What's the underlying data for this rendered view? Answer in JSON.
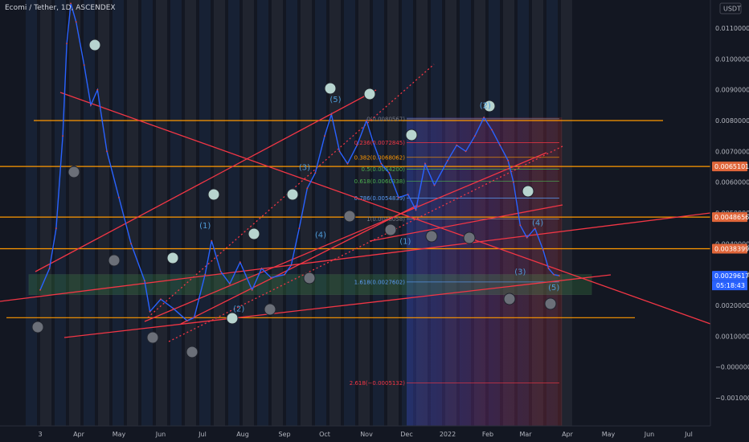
{
  "header": {
    "title": "Ecomi / Tether, 1D, ASCENDEX"
  },
  "currency_button": {
    "label": "USDT"
  },
  "price_tags": [
    {
      "label": "0.0065101",
      "value": 0.0065101,
      "color": "#e0663a"
    },
    {
      "label": "0.0048656",
      "value": 0.0048656,
      "color": "#e0663a"
    },
    {
      "label": "0.0038399",
      "value": 0.0038399,
      "color": "#e0663a"
    },
    {
      "label": "0.0029617",
      "value": 0.0029617,
      "color": "#2962ff"
    }
  ],
  "countdown": {
    "label": "05:18:43"
  },
  "colors": {
    "background": "#131722",
    "line": "#2962ff",
    "trendline": "#f23645",
    "horizontal": "#ff9800",
    "circle": "#9fbbb8",
    "wave_label": "#4f9bd6"
  },
  "chart_data": {
    "type": "line",
    "title": "Ecomi / Tether, 1D, ASCENDEX",
    "ylabel": "USDT",
    "ylim": [
      -0.00135,
      0.01185
    ],
    "y_ticks": [
      "0.0110000",
      "0.0100000",
      "0.0090000",
      "0.0080000",
      "0.0070000",
      "0.0060000",
      "0.0050000",
      "0.0040000",
      "0.0030000",
      "0.0020000",
      "0.0010000",
      "−0.0000000",
      "−0.0010000"
    ],
    "x_ticks": [
      "3",
      "Apr",
      "May",
      "Jun",
      "Jul",
      "Aug",
      "Sep",
      "Oct",
      "Nov",
      "Dec",
      "2022",
      "Feb",
      "Mar",
      "Apr",
      "May",
      "Jun",
      "Jul"
    ],
    "x_range": [
      "2021-03-03",
      "2022-07-20"
    ],
    "series": [
      {
        "name": "",
        "dates": [
          "2021-03-03",
          "2021-03-10",
          "2021-03-15",
          "2021-03-20",
          "2021-03-23",
          "2021-03-26",
          "2021-03-30",
          "2021-04-05",
          "2021-04-10",
          "2021-04-15",
          "2021-04-22",
          "2021-05-01",
          "2021-05-10",
          "2021-05-20",
          "2021-05-24",
          "2021-06-01",
          "2021-06-10",
          "2021-06-20",
          "2021-06-25",
          "2021-07-03",
          "2021-07-08",
          "2021-07-15",
          "2021-07-22",
          "2021-07-30",
          "2021-08-08",
          "2021-08-15",
          "2021-08-22",
          "2021-09-01",
          "2021-09-06",
          "2021-09-12",
          "2021-09-18",
          "2021-09-24",
          "2021-10-01",
          "2021-10-06",
          "2021-10-12",
          "2021-10-18",
          "2021-10-25",
          "2021-11-01",
          "2021-11-06",
          "2021-11-12",
          "2021-11-18",
          "2021-11-25",
          "2021-12-02",
          "2021-12-08",
          "2021-12-15",
          "2021-12-22",
          "2022-01-01",
          "2022-01-08",
          "2022-01-15",
          "2022-01-22",
          "2022-01-29",
          "2022-02-04",
          "2022-02-10",
          "2022-02-16",
          "2022-02-20",
          "2022-02-25",
          "2022-03-02",
          "2022-03-08",
          "2022-03-14",
          "2022-03-18",
          "2022-03-22",
          "2022-03-26"
        ],
        "values": [
          0.0025,
          0.0032,
          0.0045,
          0.0075,
          0.0105,
          0.0118,
          0.0112,
          0.0098,
          0.0085,
          0.009,
          0.007,
          0.0055,
          0.004,
          0.0028,
          0.0018,
          0.0022,
          0.0019,
          0.0015,
          0.0016,
          0.003,
          0.0041,
          0.0031,
          0.0027,
          0.0034,
          0.0025,
          0.0032,
          0.0029,
          0.003,
          0.0033,
          0.0045,
          0.0058,
          0.0063,
          0.0075,
          0.0082,
          0.007,
          0.0066,
          0.0072,
          0.008,
          0.0073,
          0.0066,
          0.0063,
          0.0055,
          0.0056,
          0.0051,
          0.0066,
          0.0059,
          0.0067,
          0.0072,
          0.007,
          0.0075,
          0.0081,
          0.0077,
          0.0072,
          0.0067,
          0.006,
          0.0046,
          0.0042,
          0.0045,
          0.0038,
          0.0032,
          0.003,
          0.0029617
        ]
      }
    ],
    "horizontal_levels": [
      0.008,
      0.0065101,
      0.0048656,
      0.0038399,
      0.0016
    ],
    "fib_levels": [
      {
        "label": "0(0.0080567)",
        "value": 0.0080567,
        "color": "#787b86"
      },
      {
        "label": "0.236(0.0072845)",
        "value": 0.0072845,
        "color": "#f23645"
      },
      {
        "label": "0.382(0.0068062)",
        "value": 0.0068062,
        "color": "#ff9800"
      },
      {
        "label": "0.5(0.0064200)",
        "value": 0.00642,
        "color": "#4caf50"
      },
      {
        "label": "0.618(0.0060338)",
        "value": 0.0060338,
        "color": "#4caf50"
      },
      {
        "label": "0.786(0.0054839)",
        "value": 0.0054839,
        "color": "#5b9cf6"
      },
      {
        "label": "1(0.0048058)",
        "value": 0.0048058,
        "color": "#787b86"
      },
      {
        "label": "1.618(0.0027602)",
        "value": 0.0027602,
        "color": "#5b9cf6"
      },
      {
        "label": "2.618(−0.0005132)",
        "value": -0.0005132,
        "color": "#f23645"
      }
    ],
    "wave_labels": [
      {
        "text": "(1)",
        "date": "2021-07-03",
        "value": 0.0045
      },
      {
        "text": "(2)",
        "date": "2021-07-29",
        "value": 0.0018
      },
      {
        "text": "(3)",
        "date": "2021-09-16",
        "value": 0.0064
      },
      {
        "text": "(4)",
        "date": "2021-09-28",
        "value": 0.0042
      },
      {
        "text": "(5)",
        "date": "2021-10-09",
        "value": 0.0086
      },
      {
        "text": "(1)",
        "date": "2021-11-30",
        "value": 0.004
      },
      {
        "text": "(2)",
        "date": "2022-01-30",
        "value": 0.0084
      },
      {
        "text": "(3)",
        "date": "2022-02-25",
        "value": 0.003
      },
      {
        "text": "(4)",
        "date": "2022-03-10",
        "value": 0.0046
      },
      {
        "text": "(5)",
        "date": "2022-03-22",
        "value": 0.0025
      }
    ],
    "grid": false,
    "legend": "none"
  }
}
